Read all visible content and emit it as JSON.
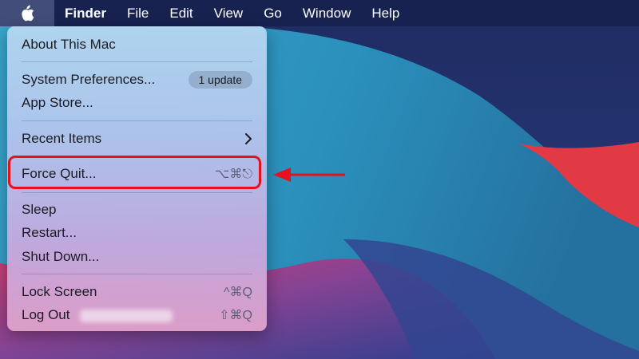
{
  "menubar": {
    "apple_icon": "apple-logo-icon",
    "app_name": "Finder",
    "menus": [
      "File",
      "Edit",
      "View",
      "Go",
      "Window",
      "Help"
    ]
  },
  "apple_menu": {
    "about": "About This Mac",
    "system_preferences": "System Preferences...",
    "update_badge": "1 update",
    "app_store": "App Store...",
    "recent_items": "Recent Items",
    "force_quit": "Force Quit...",
    "force_quit_shortcut": "⌥⌘⎋",
    "sleep": "Sleep",
    "restart": "Restart...",
    "shut_down": "Shut Down...",
    "lock_screen": "Lock Screen",
    "lock_screen_shortcut": "^⌘Q",
    "log_out": "Log Out",
    "log_out_shortcut": "⇧⌘Q"
  },
  "annotation": {
    "highlight_color": "#e8101c"
  }
}
